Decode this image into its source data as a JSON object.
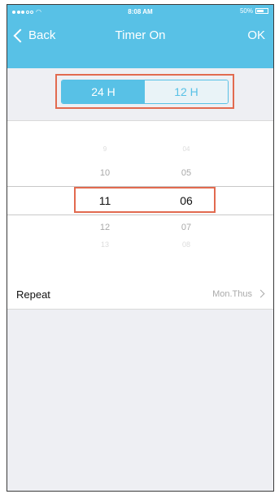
{
  "status_bar": {
    "carrier": "",
    "time": "8:08 AM",
    "battery": "50%"
  },
  "nav": {
    "back_label": "Back",
    "title": "Timer On",
    "ok_label": "OK"
  },
  "mode_toggle": {
    "options": [
      "24 H",
      "12 H"
    ],
    "selected": "24 H"
  },
  "picker": {
    "hours": [
      "9",
      "10",
      "11",
      "12",
      "13"
    ],
    "minutes": [
      "04",
      "05",
      "06",
      "07",
      "08"
    ],
    "selected_hour": "11",
    "selected_minute": "06"
  },
  "repeat": {
    "label": "Repeat",
    "value": "Mon.Thus"
  },
  "colors": {
    "accent": "#58c1e6",
    "highlight_outline": "#e26a4f",
    "background": "#eeeff3"
  }
}
